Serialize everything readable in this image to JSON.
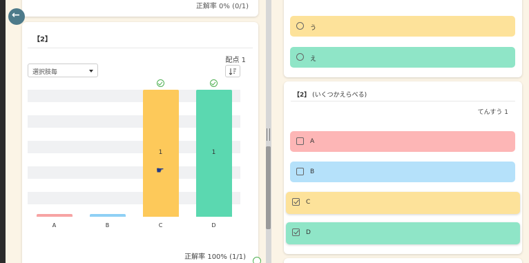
{
  "left": {
    "top_rate": "正解率 0% (0/1)",
    "question_title": "【2】",
    "points": "配点 1",
    "select_value": "選択肢毎",
    "footer_rate": "正解率 100% (1/1)"
  },
  "chart_data": {
    "type": "bar",
    "categories": [
      "A",
      "B",
      "C",
      "D"
    ],
    "values": [
      0,
      0,
      1,
      1
    ],
    "colors": [
      "#f7a4a4",
      "#8fd0f5",
      "#fdc95a",
      "#5bd8b0"
    ],
    "correct": [
      false,
      false,
      true,
      true
    ],
    "ylim": [
      0,
      1
    ],
    "grid": "horizontal bands"
  },
  "right": {
    "q1_options": [
      {
        "label": "う",
        "color": "#fde29a"
      },
      {
        "label": "え",
        "color": "#8fe5c7"
      }
    ],
    "q2_title_num": "【2】",
    "q2_title_text": "(いくつかえらべる)",
    "q2_points": "てんすう 1",
    "q2_options": [
      {
        "label": "A",
        "color": "#fdb6b6",
        "checked": false
      },
      {
        "label": "B",
        "color": "#b5e1fa",
        "checked": false
      },
      {
        "label": "C",
        "color": "#fde29a",
        "checked": true
      },
      {
        "label": "D",
        "color": "#8fe5c7",
        "checked": true
      }
    ]
  },
  "icons": {
    "back": "arrow-left-icon",
    "sort": "sort-icon",
    "check": "check-circle-icon"
  }
}
